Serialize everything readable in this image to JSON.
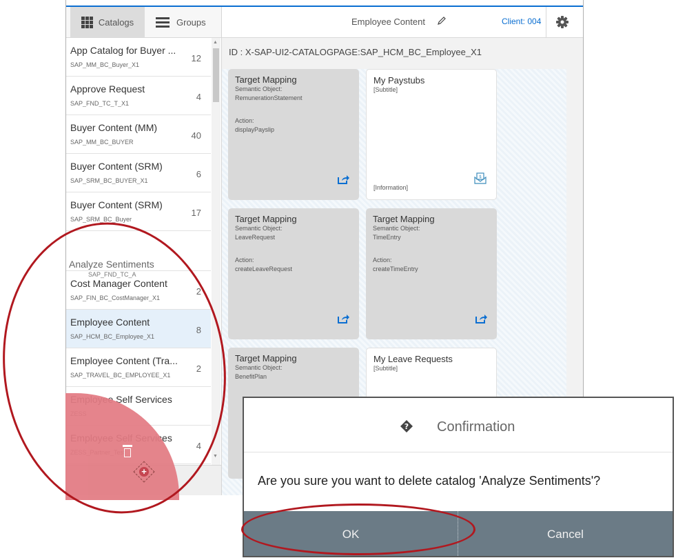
{
  "sidebar": {
    "tabs": [
      {
        "label": "Catalogs",
        "icon": "grid-icon",
        "active": true
      },
      {
        "label": "Groups",
        "icon": "menu-icon",
        "active": false
      }
    ],
    "catalogs": [
      {
        "title": "App Catalog for Buyer ...",
        "id": "SAP_MM_BC_Buyer_X1",
        "count": "12"
      },
      {
        "title": "Approve Request",
        "id": "SAP_FND_TC_T_X1",
        "count": "4"
      },
      {
        "title": "Buyer Content (MM)",
        "id": "SAP_MM_BC_BUYER",
        "count": "40"
      },
      {
        "title": "Buyer Content (SRM)",
        "id": "SAP_SRM_BC_BUYER_X1",
        "count": "6"
      },
      {
        "title": "Buyer Content (SRM)",
        "id": "SAP_SRM_BC_Buyer",
        "count": "17"
      },
      {
        "title": "Cost Manager Content",
        "id": "SAP_FIN_BC_CostManager_X1",
        "count": "2"
      },
      {
        "title": "Employee Content",
        "id": "SAP_HCM_BC_Employee_X1",
        "count": "8"
      },
      {
        "title": "Employee Content (Tra...",
        "id": "SAP_TRAVEL_BC_EMPLOYEE_X1",
        "count": "2"
      },
      {
        "title": "Employee Self Services",
        "id": "ZESS",
        "count": ""
      },
      {
        "title": "Employee Self Services",
        "id": "ZESS_Partner_Test",
        "count": "4"
      }
    ],
    "dragged": {
      "title": "Analyze Sentiments",
      "id": "SAP_FND_TC_A"
    }
  },
  "header": {
    "title": "Employee Content",
    "client": "Client: 004"
  },
  "content": {
    "catalog_id": "ID : X-SAP-UI2-CATALOGPAGE:SAP_HCM_BC_Employee_X1",
    "tiles": [
      {
        "type": "mapping",
        "title": "Target Mapping",
        "so_label": "Semantic Object:",
        "so": "RemunerationStatement",
        "action_label": "Action:",
        "action": "displayPayslip"
      },
      {
        "type": "app",
        "title": "My Paystubs",
        "subtitle": "[Subtitle]",
        "info": "[Information]"
      },
      {
        "type": "mapping",
        "title": "Target Mapping",
        "so_label": "Semantic Object:",
        "so": "LeaveRequest",
        "action_label": "Action:",
        "action": "createLeaveRequest"
      },
      {
        "type": "mapping",
        "title": "Target Mapping",
        "so_label": "Semantic Object:",
        "so": "TimeEntry",
        "action_label": "Action:",
        "action": "createTimeEntry"
      },
      {
        "type": "mapping",
        "title": "Target Mapping",
        "so_label": "Semantic Object:",
        "so": "BenefitPlan"
      },
      {
        "type": "app",
        "title": "My Leave Requests",
        "subtitle": "[Subtitle]"
      }
    ]
  },
  "dialog": {
    "title": "Confirmation",
    "message": "Are you sure you want to delete catalog 'Analyze Sentiments'?",
    "ok": "OK",
    "cancel": "Cancel"
  },
  "colors": {
    "accent": "#0a6ed1",
    "delete_area": "#e37b83",
    "annotation": "#b1181f",
    "dialog_button": "#6b7b86"
  }
}
